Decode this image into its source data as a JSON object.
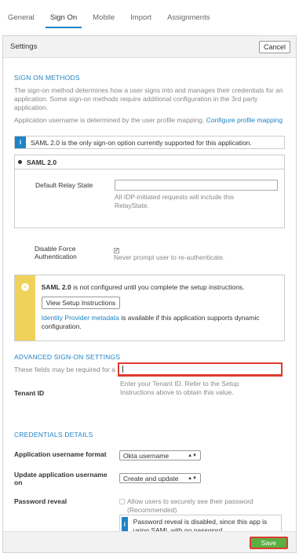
{
  "tabs": [
    {
      "label": "General"
    },
    {
      "label": "Sign On"
    },
    {
      "label": "Mobile"
    },
    {
      "label": "Import"
    },
    {
      "label": "Assignments"
    }
  ],
  "panel": {
    "title": "Settings",
    "cancel_label": "Cancel"
  },
  "sign_on_methods": {
    "title": "SIGN ON METHODS",
    "description": "The sign-on method determines how a user signs into and manages their credentials for an application. Some sign-on methods require additional configuration in the 3rd party application.",
    "username_note": "Application username is determined by the user profile mapping.",
    "username_link": "Configure profile mapping",
    "info_text": "SAML 2.0 is the only sign-on option currently supported for this application."
  },
  "saml": {
    "label": "SAML 2.0",
    "relay_label": "Default Relay State",
    "relay_value": "",
    "relay_help": "All IDP-initiated requests will include this RelayState.",
    "force_auth_label": "Disable Force Authentication",
    "force_auth_help": "Never prompt user to re-authenticate."
  },
  "setup_warning": {
    "bold": "SAML 2.0",
    "text": " is not configured until you complete the setup instructions.",
    "button_label": "View Setup Instructions",
    "metadata_link": "Identity Provider metadata",
    "metadata_text": " is available if this application supports dynamic configuration."
  },
  "advanced": {
    "title": "ADVANCED SIGN-ON SETTINGS",
    "description": "These fields may be required for a Coda proprietary sign-on option or general setting.",
    "tenant_label": "Tenant ID",
    "tenant_value": "",
    "tenant_help": "Enter your Tenant ID. Refer to the Setup Instructions above to obtain this value."
  },
  "credentials": {
    "title": "CREDENTIALS DETAILS",
    "username_format_label": "Application username format",
    "username_format_value": "Okta username",
    "update_label": "Update application username on",
    "update_value": "Create and update",
    "reveal_label": "Password reveal",
    "reveal_checkbox_text": "Allow users to securely see their password (Recommended)",
    "reveal_info": "Password reveal is disabled, since this app is using SAML with no password."
  },
  "footer": {
    "save_label": "Save"
  },
  "colors": {
    "accent": "#1f83c6",
    "save_green": "#5aae44",
    "highlight_red": "#e03a2c",
    "warning_yellow": "#f0d15a"
  }
}
